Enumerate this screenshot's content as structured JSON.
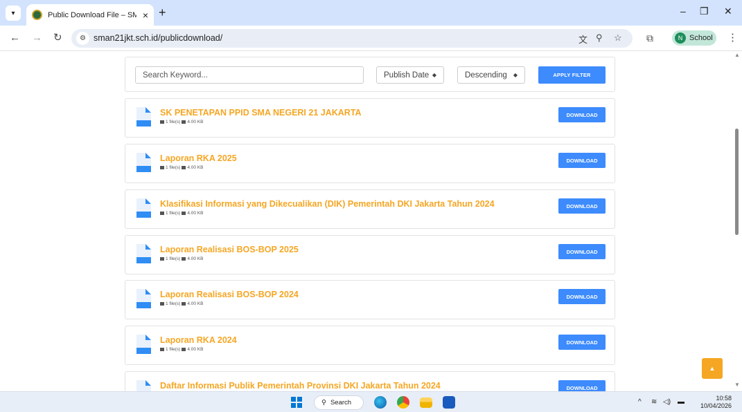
{
  "browser": {
    "tab_title": "Public Download File – SMA Ne",
    "new_tab": "+",
    "url": "sman21jkt.sch.id/publicdownload/",
    "profile_initial": "N",
    "profile_name": "School"
  },
  "filter": {
    "search_placeholder": "Search Keyword...",
    "sort_field": "Publish Date",
    "sort_order": "Descending",
    "apply_label": "APPLY FILTER"
  },
  "downloads": [
    {
      "title": "SK PENETAPAN PPID SMA NEGERI 21 JAKARTA",
      "files": "1 file(s)",
      "size": "4.00 KB",
      "button": "DOWNLOAD"
    },
    {
      "title": "Laporan RKA 2025",
      "files": "1 file(s)",
      "size": "4.00 KB",
      "button": "DOWNLOAD"
    },
    {
      "title": "Klasifikasi Informasi yang Dikecualikan (DIK) Pemerintah DKI Jakarta Tahun 2024",
      "files": "1 file(s)",
      "size": "4.00 KB",
      "button": "DOWNLOAD"
    },
    {
      "title": "Laporan Realisasi BOS-BOP 2025",
      "files": "1 file(s)",
      "size": "4.00 KB",
      "button": "DOWNLOAD"
    },
    {
      "title": "Laporan Realisasi BOS-BOP 2024",
      "files": "1 file(s)",
      "size": "4.00 KB",
      "button": "DOWNLOAD"
    },
    {
      "title": "Laporan RKA 2024",
      "files": "1 file(s)",
      "size": "4.00 KB",
      "button": "DOWNLOAD"
    },
    {
      "title": "Daftar Informasi Publik Pemerintah Provinsi DKI Jakarta Tahun 2024",
      "files": "",
      "size": "",
      "button": "DOWNLOAD"
    }
  ],
  "taskbar": {
    "search_label": "Search",
    "time": "10:58",
    "date": "10/04/2026"
  },
  "colors": {
    "accent_blue": "#3d8bfd",
    "title_orange": "#f5a623",
    "tabstrip": "#d3e3fd"
  },
  "icons": [
    "tab-search-icon",
    "back-icon",
    "forward-icon",
    "reload-icon",
    "site-info-icon",
    "translate-icon",
    "zoom-icon",
    "bookmark-star-icon",
    "extensions-icon",
    "menu-icon",
    "file-document-icon",
    "back-to-top-icon",
    "windows-start-icon"
  ]
}
